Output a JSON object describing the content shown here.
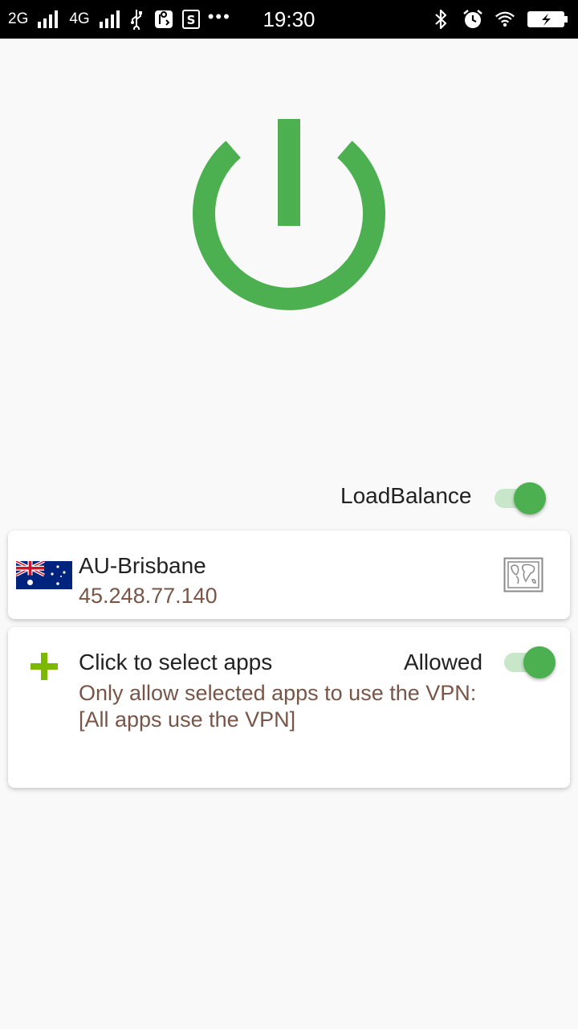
{
  "status_bar": {
    "network_1": "2G",
    "network_2": "4G",
    "time": "19:30",
    "icons": [
      "signal-bars-icon",
      "usb-icon",
      "notification-icon",
      "sim-icon",
      "more-dots-icon",
      "bluetooth-icon",
      "alarm-icon",
      "wifi-icon",
      "battery-charging-icon"
    ]
  },
  "power_button": {
    "icon": "power-icon",
    "color": "#4caf50"
  },
  "load_balance": {
    "label": "LoadBalance",
    "enabled": true
  },
  "server": {
    "flag_icon": "australia-flag-icon",
    "name": "AU-Brisbane",
    "ip": "45.248.77.140",
    "map_icon": "map-icon"
  },
  "apps": {
    "add_icon": "plus-icon",
    "title": "Click to select apps",
    "allowed_label": "Allowed",
    "allowed_enabled": true,
    "description_line_1": "Only allow selected apps to use the VPN:",
    "description_line_2": "[All apps use the VPN]"
  },
  "colors": {
    "accent": "#4caf50",
    "toggle_track": "#c8e6c9",
    "secondary_text": "#795548",
    "background": "#f9f9f9"
  }
}
